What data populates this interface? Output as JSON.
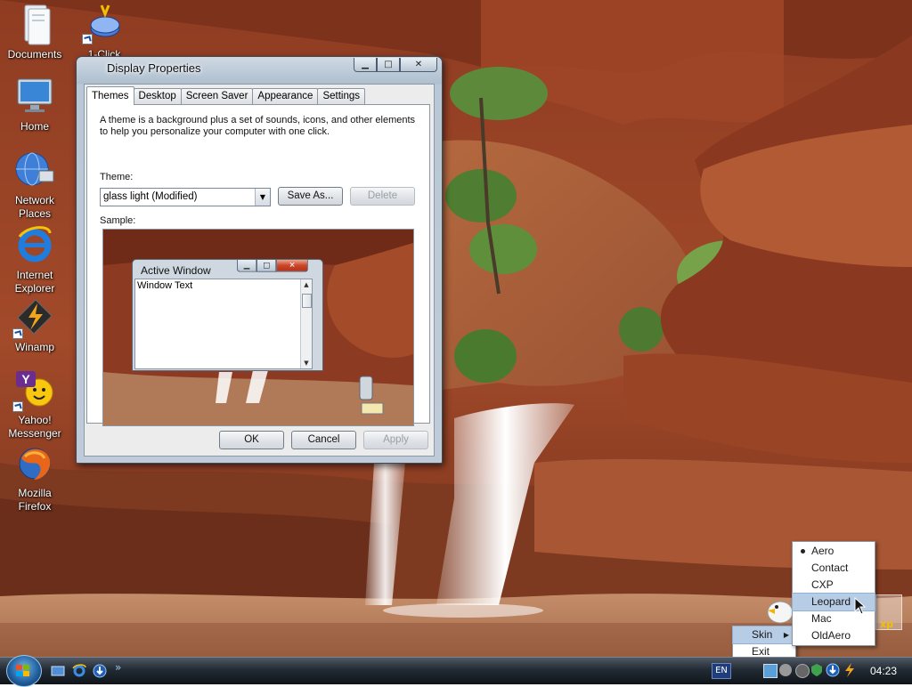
{
  "desktop_icons": [
    {
      "label": "Documents"
    },
    {
      "label": "1-Click\nMainte..."
    },
    {
      "label": "Home"
    },
    {
      "label": "Network\nPlaces"
    },
    {
      "label": "Internet\nExplorer"
    },
    {
      "label": "Winamp"
    },
    {
      "label": "Yahoo!\nMessenger"
    },
    {
      "label": "Mozilla\nFirefox"
    }
  ],
  "window": {
    "title": "Display Properties",
    "tabs": [
      "Themes",
      "Desktop",
      "Screen Saver",
      "Appearance",
      "Settings"
    ],
    "active_tab": "Themes",
    "description_line1": "A theme is a background plus a set of sounds, icons, and other elements",
    "description_line2": "to help you personalize your computer with one click.",
    "theme_label": "Theme:",
    "theme_value": "glass light (Modified)",
    "save_as_label": "Save As...",
    "delete_label": "Delete",
    "sample_label": "Sample:",
    "sample_window_title": "Active Window",
    "sample_window_text": "Window Text",
    "ok_label": "OK",
    "cancel_label": "Cancel",
    "apply_label": "Apply"
  },
  "taskbar": {
    "language": "EN",
    "clock": "04:23",
    "quicklaunch_more": "»"
  },
  "skin_menu": {
    "items": [
      "Skin",
      "Exit"
    ],
    "highlighted": "Skin"
  },
  "skin_submenu": {
    "items": [
      "Aero",
      "Contact",
      "CXP",
      "Leopard",
      "Mac",
      "OldAero"
    ],
    "selected": "Aero",
    "highlighted": "Leopard"
  },
  "colors": {
    "accent_selection": "#b7cde6",
    "taskbar": "#1b232b",
    "close_button": "#c9452a"
  }
}
